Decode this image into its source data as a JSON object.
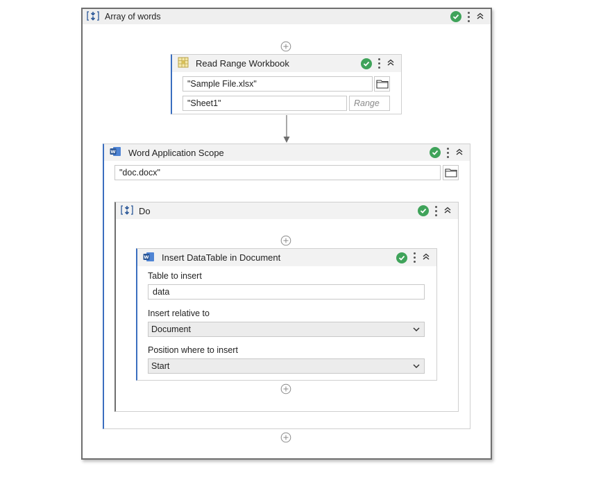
{
  "outer": {
    "title": "Array of words"
  },
  "read_range": {
    "title": "Read Range Workbook",
    "file_value": "\"Sample File.xlsx\"",
    "sheet_value": "\"Sheet1\"",
    "range_placeholder": "Range"
  },
  "word_scope": {
    "title": "Word Application Scope",
    "file_value": "\"doc.docx\""
  },
  "do_seq": {
    "title": "Do"
  },
  "insert_dt": {
    "title": "Insert DataTable in Document",
    "table_label": "Table to insert",
    "table_value": "data",
    "relative_label": "Insert relative to",
    "relative_value": "Document",
    "position_label": "Position where to insert",
    "position_value": "Start"
  },
  "colors": {
    "success": "#3fa35a",
    "accent_blue": "#3a6ebf",
    "word_blue": "#2b5797"
  },
  "icons": [
    "sequence-icon",
    "excel-range-icon",
    "word-icon",
    "check-icon",
    "kebab-icon",
    "collapse-icon",
    "add-icon",
    "folder-icon",
    "chevron-down-icon"
  ]
}
